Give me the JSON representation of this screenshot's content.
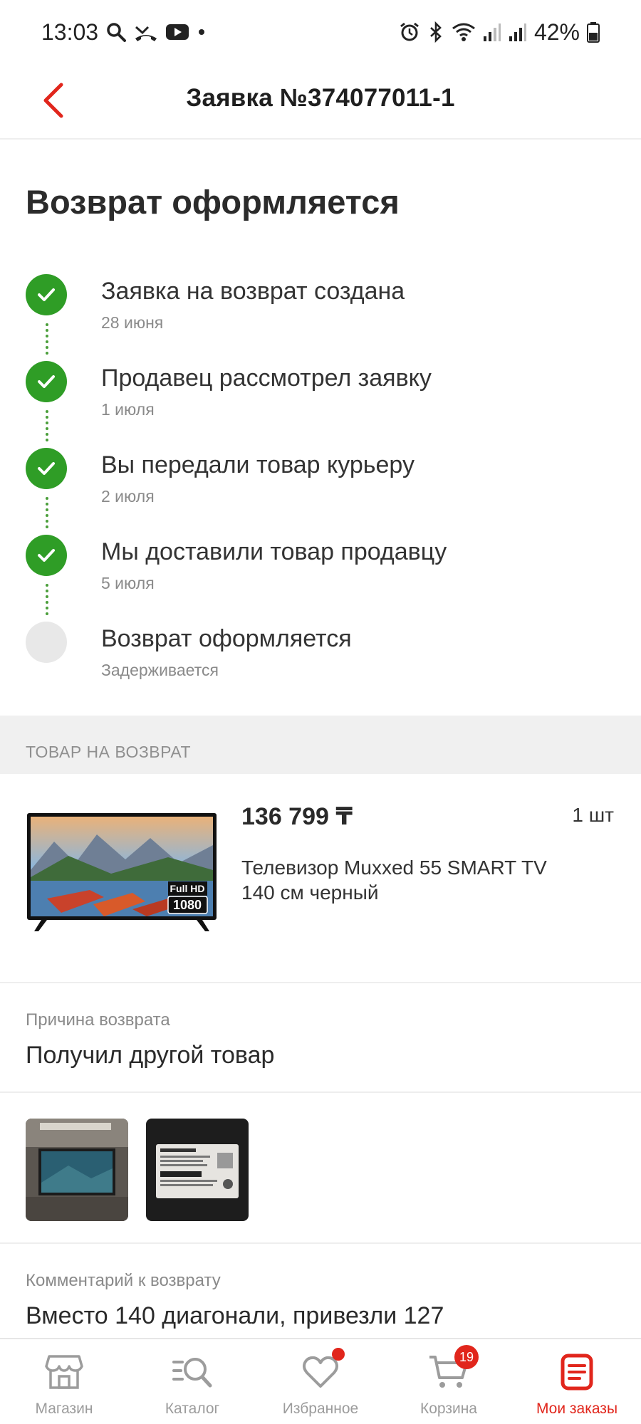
{
  "status_bar": {
    "time": "13:03",
    "battery": "42%"
  },
  "header": {
    "title": "Заявка №374077011-1"
  },
  "colors": {
    "accent": "#e1261c",
    "success": "#2f9d26",
    "pending": "#e8e8e8"
  },
  "status": {
    "title": "Возврат оформляется",
    "steps": [
      {
        "title": "Заявка на возврат создана",
        "date": "28 июня",
        "state": "done"
      },
      {
        "title": "Продавец рассмотрел заявку",
        "date": "1 июля",
        "state": "done"
      },
      {
        "title": "Вы передали товар курьеру",
        "date": "2 июля",
        "state": "done"
      },
      {
        "title": "Мы доставили товар продавцу",
        "date": "5 июля",
        "state": "done"
      },
      {
        "title": "Возврат оформляется",
        "date": "Задерживается",
        "state": "pending"
      }
    ]
  },
  "product_section": {
    "header": "ТОВАР НА ВОЗВРАТ",
    "price": "136 799 ₸",
    "quantity": "1 шт",
    "name_line1": "Телевизор Muxxed 55 SMART TV",
    "name_line2": "140 см черный",
    "image_badge_top": "Full HD",
    "image_badge_bottom": "1080"
  },
  "reason": {
    "label": "Причина возврата",
    "value": "Получил другой товар"
  },
  "comment": {
    "label": "Комментарий к возврату",
    "value": "Вместо 140 диагонали, привезли 127"
  },
  "bottom_nav": {
    "items": [
      {
        "label": "Магазин",
        "icon": "store-icon"
      },
      {
        "label": "Каталог",
        "icon": "catalog-search-icon"
      },
      {
        "label": "Избранное",
        "icon": "heart-icon"
      },
      {
        "label": "Корзина",
        "icon": "cart-icon",
        "badge": "19"
      },
      {
        "label": "Мои заказы",
        "icon": "orders-icon",
        "active": true
      }
    ]
  }
}
